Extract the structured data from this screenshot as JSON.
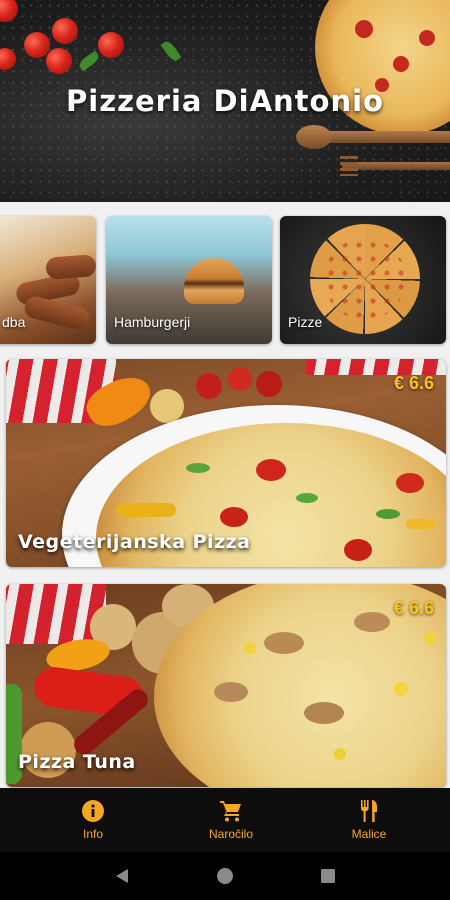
{
  "header": {
    "brand": "Pizzeria DiAntonio"
  },
  "categories": [
    {
      "label": "dba"
    },
    {
      "label": "Hamburgerji"
    },
    {
      "label": "Pizze"
    }
  ],
  "products": [
    {
      "name": "Vegeterijanska Pizza",
      "price": "€ 6.6"
    },
    {
      "name": "Pizza Tuna",
      "price": "€ 6.6"
    }
  ],
  "bottom_nav": [
    {
      "label": "Info",
      "icon": "info-icon"
    },
    {
      "label": "Naročilo",
      "icon": "cart-icon"
    },
    {
      "label": "Malice",
      "icon": "cutlery-icon"
    }
  ],
  "system_nav": [
    "back-icon",
    "home-icon",
    "recents-icon"
  ],
  "colors": {
    "accent": "#f5a623",
    "price": "#ffc21a",
    "nav_bg": "#0d0d0d"
  }
}
